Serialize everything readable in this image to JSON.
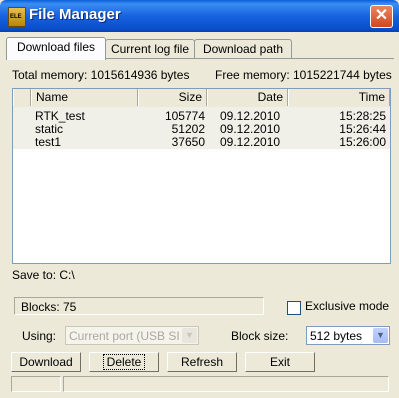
{
  "window": {
    "title": "File Manager",
    "icon_label": "ELE"
  },
  "tabs": [
    "Download files",
    "Current log file",
    "Download path"
  ],
  "memory": {
    "total": "Total memory: 1015614936 bytes",
    "free": "Free memory: 1015221744 bytes"
  },
  "files": {
    "columns": [
      "Name",
      "Size",
      "Date",
      "Time"
    ],
    "rows": [
      {
        "name": "RTK_test",
        "size": "105774",
        "date": "09.12.2010",
        "time": "15:28:25"
      },
      {
        "name": "static",
        "size": "51202",
        "date": "09.12.2010",
        "time": "15:26:44"
      },
      {
        "name": "test1",
        "size": "37650",
        "date": "09.12.2010",
        "time": "15:26:00"
      }
    ]
  },
  "save_to": "Save to: C:\\",
  "blocks": "Blocks: 75",
  "exclusive_mode": {
    "label": "Exclusive mode",
    "checked": false
  },
  "using": {
    "label": "Using:",
    "value": "Current port (USB SI"
  },
  "block_size": {
    "label": "Block size:",
    "value": "512 bytes"
  },
  "buttons": {
    "download": "Download",
    "delete": "Delete",
    "refresh": "Refresh",
    "exit": "Exit"
  }
}
